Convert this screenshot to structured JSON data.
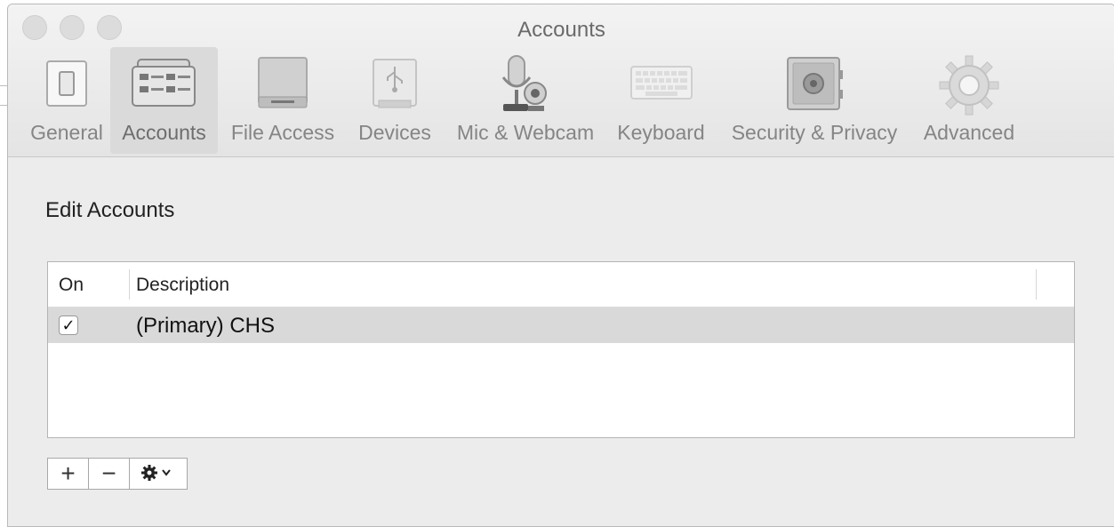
{
  "window": {
    "title": "Accounts"
  },
  "toolbar": {
    "tabs": [
      {
        "label": "General",
        "icon": "switch-icon"
      },
      {
        "label": "Accounts",
        "icon": "accounts-icon",
        "selected": true
      },
      {
        "label": "File Access",
        "icon": "drive-icon"
      },
      {
        "label": "Devices",
        "icon": "usb-icon"
      },
      {
        "label": "Mic & Webcam",
        "icon": "mic-webcam-icon"
      },
      {
        "label": "Keyboard",
        "icon": "keyboard-icon"
      },
      {
        "label": "Security & Privacy",
        "icon": "safe-icon"
      },
      {
        "label": "Advanced",
        "icon": "gear-icon"
      }
    ]
  },
  "content": {
    "heading": "Edit Accounts",
    "table": {
      "columns": [
        "On",
        "Description"
      ],
      "rows": [
        {
          "on": true,
          "check_glyph": "✓",
          "description": "(Primary) CHS"
        }
      ]
    },
    "buttons": {
      "add": "+",
      "remove": "−",
      "actions_icon": "gear-menu-icon"
    }
  },
  "colors": {
    "selected_row": "#d9d9d9",
    "window_bg": "#ececec"
  }
}
